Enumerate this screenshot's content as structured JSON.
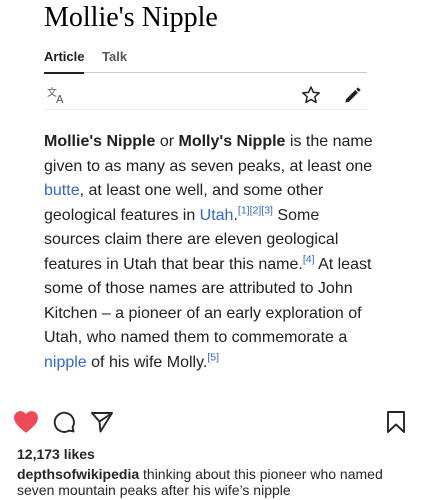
{
  "article": {
    "title": "Mollie's Nipple",
    "tabs": [
      {
        "label": "Article"
      },
      {
        "label": "Talk"
      }
    ],
    "toolbar": {
      "language_icon": "translate-icon",
      "watch_icon": "star-icon",
      "edit_icon": "pencil-icon"
    },
    "body": {
      "p1_bold1": "Mollie's Nipple",
      "p1_t1": " or ",
      "p1_bold2": "Molly's Nipple",
      "p1_t2": " is the name given to as many as seven peaks, at least one ",
      "p1_link_butte": "butte",
      "p1_t3": ", at least one well, and some other geological features in ",
      "p1_link_utah": "Utah",
      "p1_t4": ".",
      "ref1": "[1]",
      "ref2": "[2]",
      "ref3": "[3]",
      "p1_t5": " Some sources claim there are eleven geological features in Utah that bear this name.",
      "ref4": "[4]",
      "p1_t6": " At least some of those names are attributed to John Kitchen – a pioneer of an early exploration of Utah, who named them to commemorate a ",
      "p1_link_nipple": "nipple",
      "p1_t7": " of his wife Molly.",
      "ref5": "[5]"
    }
  },
  "post": {
    "actions": {
      "like_icon": "heart-icon",
      "comment_icon": "comment-icon",
      "share_icon": "send-icon",
      "save_icon": "bookmark-icon",
      "like_color": "#ed4956"
    },
    "likes": "12,173 likes",
    "username": "depthsofwikipedia",
    "caption": " thinking about this pioneer who named seven mountain peaks after his wife’s nipple"
  }
}
